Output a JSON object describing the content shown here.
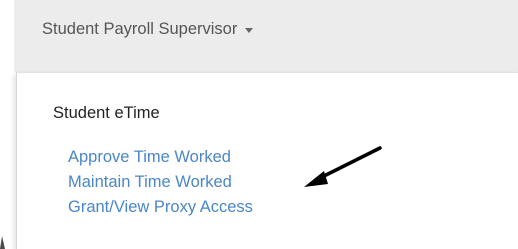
{
  "header": {
    "role_menu_label": "Student Payroll Supervisor"
  },
  "menu": {
    "section_heading": "Student eTime",
    "items": [
      {
        "label": "Approve Time Worked"
      },
      {
        "label": "Maintain Time Worked"
      },
      {
        "label": "Grant/View Proxy Access"
      }
    ]
  },
  "annotation": {
    "arrow_icon": "arrow-pointing-left",
    "arrow_color": "#000000"
  },
  "colors": {
    "link": "#4a86c8",
    "top_bar_background": "#ececec",
    "role_text": "#555555"
  }
}
